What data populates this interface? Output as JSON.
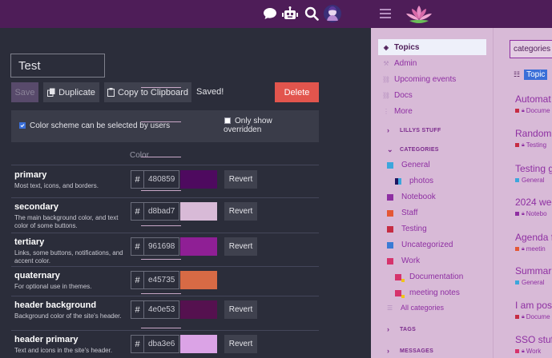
{
  "header": {
    "icons": [
      "chat-icon",
      "robot-icon",
      "search-icon",
      "avatar"
    ]
  },
  "scheme": {
    "name_value": "Test",
    "save_label": "Save",
    "duplicate_label": "Duplicate",
    "copy_label": "Copy to Clipboard",
    "saved_status": "Saved!",
    "delete_label": "Delete",
    "option_user_selectable": "Color scheme can be selected by users",
    "option_user_selectable_checked": true,
    "option_show_overridden": "Only show overridden",
    "option_show_overridden_checked": false,
    "color_column_header": "Color",
    "revert_label": "Revert",
    "colors": [
      {
        "name": "primary",
        "desc": "Most text, icons, and borders.",
        "hex": "480859",
        "swatch": "#4e0a5f",
        "revert": true
      },
      {
        "name": "secondary",
        "desc": "The main background color, and text color of some buttons.",
        "hex": "d8bad7",
        "swatch": "#d8bad7",
        "revert": true
      },
      {
        "name": "tertiary",
        "desc": "Links, some buttons, notifications, and accent color.",
        "hex": "961698",
        "swatch": "#8f1f95",
        "revert": true
      },
      {
        "name": "quaternary",
        "desc": "For optional use in themes.",
        "hex": "e45735",
        "swatch": "#d76a45",
        "revert": false
      },
      {
        "name": "header background",
        "desc": "Background color of the site's header.",
        "hex": "4e0e53",
        "swatch": "#55114f",
        "revert": true
      },
      {
        "name": "header primary",
        "desc": "Text and icons in the site's header.",
        "hex": "dba3e6",
        "swatch": "#dba3e6",
        "revert": true
      }
    ]
  },
  "sidebar": {
    "nav": [
      {
        "label": "Topics",
        "icon": "layers-icon",
        "active": true
      },
      {
        "label": "Admin",
        "icon": "wrench-icon",
        "active": false
      },
      {
        "label": "Upcoming events",
        "icon": "calendar-icon",
        "active": false
      },
      {
        "label": "Docs",
        "icon": "link-icon",
        "active": false
      },
      {
        "label": "More",
        "icon": "more-icon",
        "active": false
      }
    ],
    "section_lillys": "LILLYS STUFF",
    "section_categories": "CATEGORIES",
    "categories": [
      {
        "label": "General",
        "color": "#3ca6dc",
        "sub": false,
        "style": "plain"
      },
      {
        "label": "photos",
        "color": "#3ca6dc",
        "sub": true,
        "style": "half"
      },
      {
        "label": "Notebook",
        "color": "#8e2fa2",
        "sub": false,
        "style": "plain"
      },
      {
        "label": "Staff",
        "color": "#e45735",
        "sub": false,
        "style": "plain"
      },
      {
        "label": "Testing",
        "color": "#c62c43",
        "sub": false,
        "style": "plain"
      },
      {
        "label": "Uncategorized",
        "color": "#3a7bd5",
        "sub": false,
        "style": "plain"
      },
      {
        "label": "Work",
        "color": "#d6336c",
        "sub": false,
        "style": "plain"
      },
      {
        "label": "Documentation",
        "color": "#c62c43",
        "sub": true,
        "style": "tag"
      },
      {
        "label": "meeting notes",
        "color": "#e45735",
        "sub": true,
        "style": "tag"
      }
    ],
    "all_categories": "All categories",
    "section_tags": "TAGS",
    "section_messages": "MESSAGES"
  },
  "main": {
    "filter_value": "categories",
    "topic_tab": "Topic",
    "topics": [
      {
        "title": "Automat",
        "cat": "Docume",
        "cat_color": "#c62c43",
        "locked": true
      },
      {
        "title": "Random",
        "cat": "Testing",
        "cat_color": "#c62c43",
        "locked": true
      },
      {
        "title": "Testing g",
        "cat": "General",
        "cat_color": "#3ca6dc",
        "locked": false
      },
      {
        "title": "2024 wee",
        "cat": "Notebo",
        "cat_color": "#8e2fa2",
        "locked": true
      },
      {
        "title": "Agenda f",
        "cat": "meetin",
        "cat_color": "#e45735",
        "locked": true
      },
      {
        "title": "Summar",
        "cat": "General",
        "cat_color": "#3ca6dc",
        "locked": false
      },
      {
        "title": "I am pos",
        "cat": "Docume",
        "cat_color": "#c62c43",
        "locked": true
      },
      {
        "title": "SSO stuff",
        "cat": "Work",
        "cat_color": "#d6336c",
        "locked": true
      }
    ]
  }
}
